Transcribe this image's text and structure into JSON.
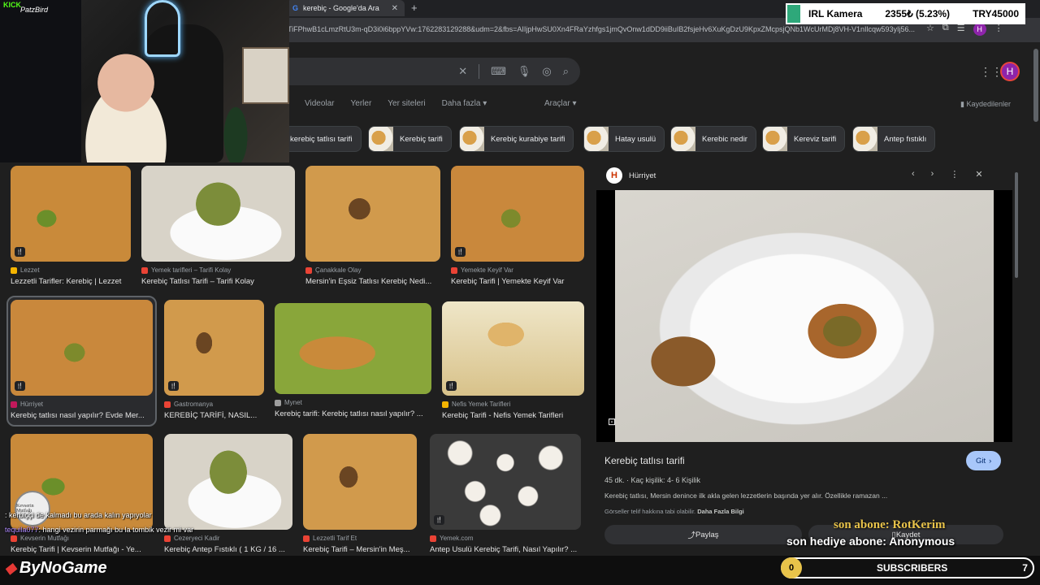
{
  "browser": {
    "tab_title": "kerebiç - Google'da Ara",
    "tab_close": "✕",
    "new_tab": "+",
    "url": "TiFPhwB1cLmzRtU3m-qD3i0i6bppYVw:1762283129288&udm=2&fbs=AIIjpHwSU0Xn4FRaYzhfgs1jmQvOnw1dDD9iiBuIB2fsjeHv6XuKgDzU9KpxZMcpsjQNb1WcUrMDj8VH-V1nIlcqw593yIj56...",
    "profile_letter": "H"
  },
  "google": {
    "search_icons": [
      "keyboard-icon",
      "mic-icon",
      "lens-icon",
      "search-icon"
    ],
    "profile_letter": "H",
    "nav_tabs": [
      "Videolar",
      "Yerler",
      "Yer siteleri",
      "Daha fazla ▾"
    ],
    "tools_label": "Araçlar ▾",
    "saved_label": "Kaydedilenler",
    "chips": [
      {
        "label": "kerebiç tatlısı tarifi"
      },
      {
        "label": "Kerebiç tarifi"
      },
      {
        "label": "Kerebiç kurabiye tarifi"
      },
      {
        "label": "Hatay usulü"
      },
      {
        "label": "Kerebic nedir"
      },
      {
        "label": "Kereviz tarifi"
      },
      {
        "label": "Antep fıstıklı"
      }
    ],
    "results": [
      {
        "source": "Lezzet",
        "title": "Lezzetli Tarifler: Kerebiç | Lezzet",
        "fav": "#f4b400"
      },
      {
        "source": "Yemek tarifleri – Tarifi Kolay",
        "title": "Kerebiç Tatlısı Tarifi – Tarifi Kolay",
        "fav": "#ea4335"
      },
      {
        "source": "Çanakkale Olay",
        "title": "Mersin'in Eşsiz Tatlısı Kerebiç Nedi...",
        "fav": "#ea4335"
      },
      {
        "source": "Yemekte Keyif Var",
        "title": "Kerebiç Tarifi | Yemekte Keyif Var",
        "fav": "#ea4335"
      },
      {
        "source": "Hürriyet",
        "title": "Kerebiç tatlısı nasıl yapılır? Evde Mer...",
        "fav": "#c2185b"
      },
      {
        "source": "Gastromanya",
        "title": "KEREBİÇ TARİFİ, NASIL...",
        "fav": "#ea4335"
      },
      {
        "source": "Mynet",
        "title": "Kerebiç tarifi: Kerebiç tatlısı nasıl yapılır? ...",
        "fav": "#9e9e9e"
      },
      {
        "source": "Nefis Yemek Tarifleri",
        "title": "Kerebiç Tarifi - Nefis Yemek Tarifleri",
        "fav": "#f4b400"
      },
      {
        "source": "Kevserin Mutfağı",
        "title": "Kerebiç Tarifi | Kevserin Mutfağı - Ye...",
        "fav": "#ea4335"
      },
      {
        "source": "Cezeryeci Kadir",
        "title": "Kerebiç Antep Fıstıklı ( 1 KG / 16 ...",
        "fav": "#ea4335"
      },
      {
        "source": "Lezzetli Tarif Et",
        "title": "Kerebiç Tarifi – Mersin'in Meş...",
        "fav": "#ea4335"
      },
      {
        "source": "Yemek.com",
        "title": "Antep Usulü Kerebiç Tarifi, Nasıl Yapılır? ...",
        "fav": "#ea4335"
      }
    ]
  },
  "preview": {
    "source": "Hürriyet",
    "source_icon_letter": "H",
    "title": "Kerebiç tatlısı tarifi",
    "visit_label": "Git",
    "meta": "45 dk. · Kaç kişilik: 4- 6 Kişilik",
    "description": "Kerebiç tatlısı, Mersin denince ilk akla gelen lezzetlerin başında yer alır. Özellikle ramazan ...",
    "copyright": "Görseller telif hakkına tabi olabilir.",
    "more_info": "Daha Fazla Bilgi",
    "share_label": "Paylaş",
    "save_label": "Kaydet"
  },
  "overlay": {
    "kick_logo": "KICK",
    "streamer_name": "PatzBird",
    "ticker": {
      "label": "IRL Kamera",
      "amount": "2355₺ (5.23%)",
      "goal": "TRY45000",
      "accent": "#2ea87a"
    },
    "chat": [
      {
        "user": "",
        "text": ": kerbiççi de kalmadı bu arada kalın yapıyolar"
      },
      {
        "user": "tequila077",
        "text": ": hangi vezirin parmağı bu la tombik vezir mi var"
      }
    ],
    "chat_badge": "Kevserin Mutfağı",
    "last_sub": "son abone: RotKerim",
    "last_gift": "son hediye abone: Anonymous",
    "brand": "ByNoGame",
    "sub_goal": {
      "current": "0",
      "label": "SUBSCRIBERS",
      "target": "7"
    }
  }
}
